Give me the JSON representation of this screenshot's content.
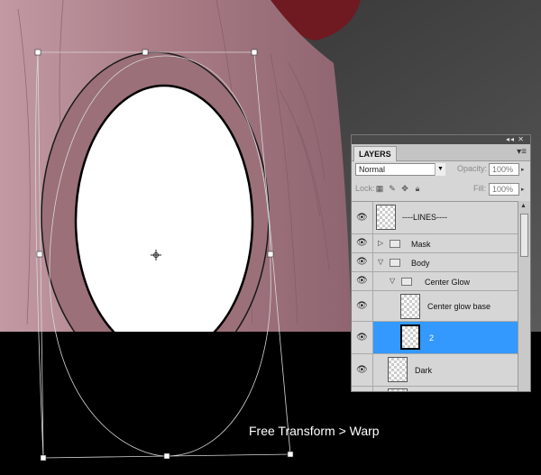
{
  "caption": "Free Transform > Warp",
  "canvas": {
    "skin_color": "#b08690",
    "eye_color": "#ffffff",
    "below_color": "#000000",
    "hair_color": "#7a1e24",
    "background_color": "#4a4a4a"
  },
  "layers_panel": {
    "tab_label": "LAYERS",
    "topbar_glyph": "◂◂ ✕",
    "menu_icon": "panel-menu-icon",
    "blend_mode": "Normal",
    "opacity_label": "Opacity:",
    "opacity_value": "100%",
    "lock_label": "Lock:",
    "lock_icons": [
      "transparency-lock-icon",
      "brush-lock-icon",
      "move-lock-icon",
      "padlock-icon"
    ],
    "fill_label": "Fill:",
    "fill_value": "100%",
    "selection_color": "#3399ff",
    "layers": [
      {
        "name": "----LINES----",
        "type": "layer"
      },
      {
        "name": "Mask",
        "type": "group",
        "expanded": false
      },
      {
        "name": "Body",
        "type": "group",
        "expanded": true
      },
      {
        "name": "Center Glow",
        "type": "group",
        "expanded": true
      },
      {
        "name": "Center glow base",
        "type": "layer"
      },
      {
        "name": "2",
        "type": "layer",
        "selected": true
      },
      {
        "name": "Dark",
        "type": "layer"
      }
    ]
  }
}
